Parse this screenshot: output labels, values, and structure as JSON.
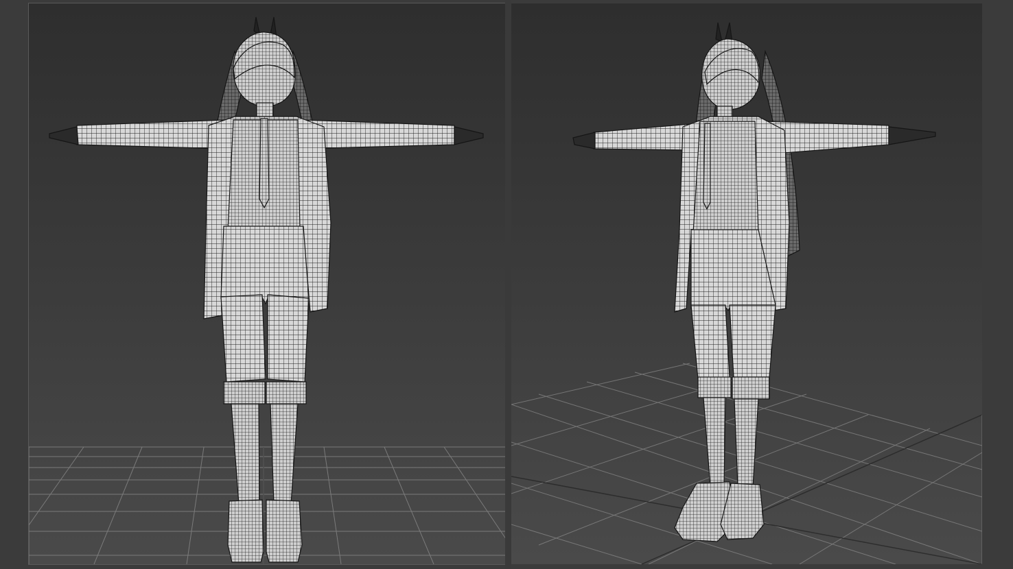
{
  "viewports": [
    {
      "label": "",
      "view": "front",
      "shading": "wireframe-over-shaded"
    },
    {
      "label": "",
      "view": "perspective",
      "shading": "wireframe-over-shaded"
    }
  ],
  "colors": {
    "background": "#3b3b3b",
    "viewport_top": "#2e2e2e",
    "viewport_bottom": "#4a4a4a",
    "grid": "#8a8a8a",
    "mesh_fill": "#d6d6d6",
    "wire": "#1a1a1a"
  },
  "icons": [
    "character-model-front",
    "character-model-perspective",
    "ground-grid"
  ]
}
